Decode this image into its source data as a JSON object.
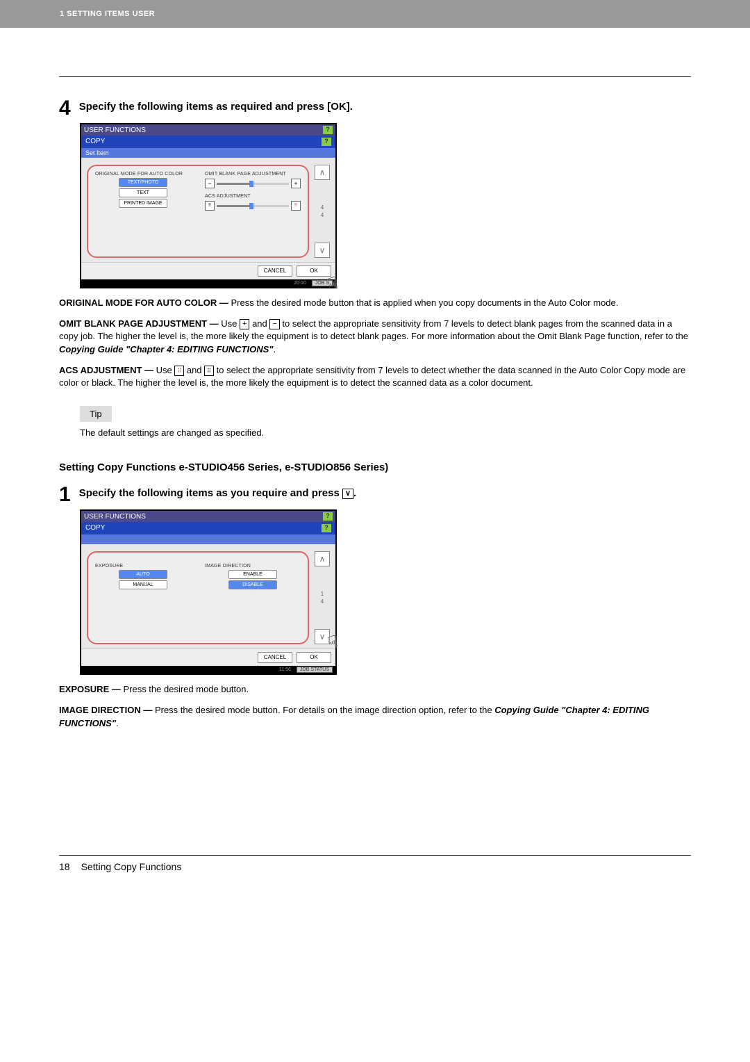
{
  "header": {
    "breadcrumb": "1 SETTING ITEMS USER"
  },
  "step4": {
    "num": "4",
    "title": "Specify the following items as required and press [OK]."
  },
  "screenshot1": {
    "titlebar": "USER FUNCTIONS",
    "tab": "COPY",
    "subbar": "Set Item",
    "col1_label": "ORIGINAL MODE FOR AUTO COLOR",
    "btn_textphoto": "TEXT/PHOTO",
    "btn_text": "TEXT",
    "btn_printed": "PRINTED IMAGE",
    "col2_label1": "OMIT BLANK PAGE ADJUSTMENT",
    "col2_label2": "ACS ADJUSTMENT",
    "page_cur": "4",
    "page_tot": "4",
    "cancel": "CANCEL",
    "ok": "OK",
    "time": "20:10",
    "jobstatus": "JOB S"
  },
  "desc_original": {
    "lead": "ORIGINAL MODE FOR AUTO COLOR — ",
    "body": "Press the desired mode button that is applied when you copy documents in the Auto Color mode."
  },
  "desc_omit": {
    "lead": "OMIT BLANK PAGE ADJUSTMENT — ",
    "pre": "Use ",
    "mid": " and ",
    "body": " to select the appropriate sensitivity from 7 levels to detect blank pages from the scanned data in a copy job. The higher the level is, the more likely the equipment is to detect blank pages. For more information about the Omit Blank Page function, refer to the ",
    "ref": "Copying Guide \"Chapter 4: EDITING FUNCTIONS\"",
    "tail": "."
  },
  "desc_acs": {
    "lead": "ACS ADJUSTMENT — ",
    "pre": "Use ",
    "mid": " and ",
    "body": " to select the appropriate sensitivity from 7 levels to detect whether the data scanned in the Auto Color Copy mode are color or black. The higher the level is, the more likely the equipment is to detect the scanned data as a color document."
  },
  "tip": {
    "label": "Tip",
    "text": "The default settings are changed as specified."
  },
  "section_heading": "Setting Copy Functions e-STUDIO456 Series, e-STUDIO856 Series)",
  "step1": {
    "num": "1",
    "title_pre": "Specify the following items as you require and press ",
    "title_post": "."
  },
  "screenshot2": {
    "titlebar": "USER FUNCTIONS",
    "tab": "COPY",
    "col1_label": "EXPOSURE",
    "btn_auto": "AUTO",
    "btn_manual": "MANUAL",
    "col2_label": "IMAGE DIRECTION",
    "btn_enable": "ENABLE",
    "btn_disable": "DISABLE",
    "page_cur": "1",
    "page_tot": "4",
    "cancel": "CANCEL",
    "ok": "OK",
    "time": "11:56",
    "jobstatus": "JOB STATUS"
  },
  "desc_exposure": {
    "lead": "EXPOSURE — ",
    "body": "Press the desired mode button."
  },
  "desc_imagedir": {
    "lead": "IMAGE DIRECTION — ",
    "body": "Press the desired mode button. For details on the image direction option, refer to the ",
    "ref": "Copying Guide \"Chapter 4: EDITING FUNCTIONS\"",
    "tail": "."
  },
  "footer": {
    "page": "18",
    "title": "Setting Copy Functions"
  }
}
